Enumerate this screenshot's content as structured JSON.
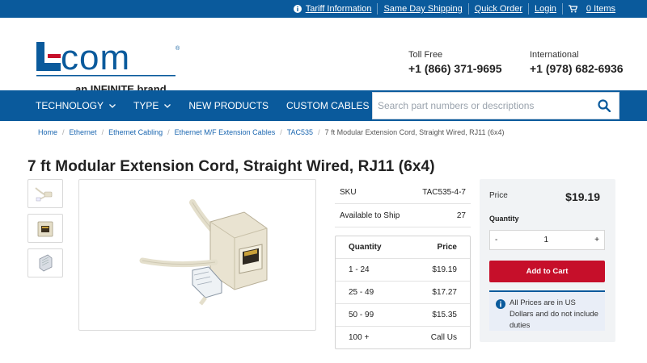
{
  "topbar": {
    "links": [
      "Tariff Information",
      "Same Day Shipping",
      "Quick Order",
      "Login",
      "0 Items"
    ]
  },
  "header": {
    "logo_text": "L-com",
    "logo_tagline": "an INFINITE brand",
    "tollfree_label": "Toll Free",
    "tollfree_number": "+1 (866) 371-9695",
    "intl_label": "International",
    "intl_number": "+1 (978) 682-6936"
  },
  "nav": {
    "items": [
      "TECHNOLOGY",
      "TYPE",
      "NEW PRODUCTS",
      "CUSTOM CABLES"
    ],
    "search_placeholder": "Search part numbers or descriptions"
  },
  "breadcrumb": [
    "Home",
    "Ethernet",
    "Ethernet Cabling",
    "Ethernet M/F Extension Cables",
    "TAC535",
    "7 ft Modular Extension Cord, Straight Wired, RJ11 (6x4)"
  ],
  "product": {
    "title": "7 ft Modular Extension Cord, Straight Wired, RJ11 (6x4)",
    "sku_label": "SKU",
    "sku_value": "TAC535-4-7",
    "ship_label": "Available to Ship",
    "ship_value": "27"
  },
  "pricing": {
    "header": [
      "Quantity",
      "Price"
    ],
    "rows": [
      [
        "1 - 24",
        "$19.19"
      ],
      [
        "25 - 49",
        "$17.27"
      ],
      [
        "50 - 99",
        "$15.35"
      ],
      [
        "100 +",
        "Call Us"
      ]
    ]
  },
  "cart": {
    "price_label": "Price",
    "price_value": "$19.19",
    "qty_label": "Quantity",
    "qty_minus": "-",
    "qty_value": "1",
    "qty_plus": "+",
    "add_label": "Add to Cart",
    "note": "All Prices are in US Dollars and do not include duties"
  },
  "colors": {
    "brand_blue": "#0a5a9c",
    "cta_red": "#c60f2a"
  }
}
